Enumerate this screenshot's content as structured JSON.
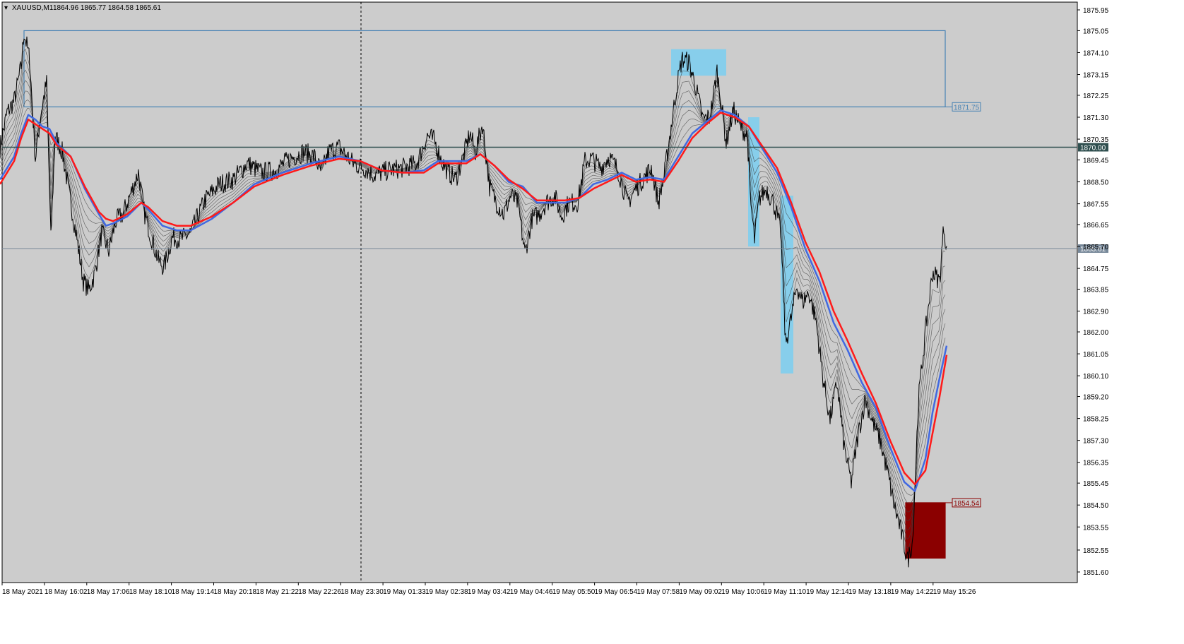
{
  "header": {
    "menu_glyph": "▾",
    "symbol": "XAUUSD,M1",
    "ohlc": "1864.96 1865.77 1864.58 1865.61"
  },
  "chart_data": {
    "type": "line",
    "title": "XAUUSD,M1",
    "ylim": [
      1851.29,
      1875.84
    ],
    "grid": false,
    "y_ticks": [
      "1875.95",
      "1875.05",
      "1874.10",
      "1873.15",
      "1872.25",
      "1871.30",
      "1870.35",
      "1869.45",
      "1868.50",
      "1867.55",
      "1866.65",
      "1865.70",
      "1864.75",
      "1863.85",
      "1862.90",
      "1862.00",
      "1861.05",
      "1860.10",
      "1859.20",
      "1858.25",
      "1857.30",
      "1856.35",
      "1855.45",
      "1854.50",
      "1853.55",
      "1852.55",
      "1851.60"
    ],
    "x_ticks": [
      "18 May 2021",
      "18 May 16:02",
      "18 May 17:06",
      "18 May 18:10",
      "18 May 19:14",
      "18 May 20:18",
      "18 May 21:22",
      "18 May 22:26",
      "18 May 23:30",
      "19 May 01:33",
      "19 May 02:38",
      "19 May 03:42",
      "19 May 04:46",
      "19 May 05:50",
      "19 May 06:54",
      "19 May 07:58",
      "19 May 09:02",
      "19 May 10:06",
      "19 May 11:10",
      "19 May 12:14",
      "19 May 13:18",
      "19 May 14:22",
      "19 May 15:26"
    ],
    "price_points": [
      [
        0,
        1870.0
      ],
      [
        10,
        1871.5
      ],
      [
        20,
        1872.0
      ],
      [
        30,
        1873.5
      ],
      [
        34,
        1875.0
      ],
      [
        42,
        1873.8
      ],
      [
        50,
        1869.5
      ],
      [
        58,
        1871.5
      ],
      [
        66,
        1872.8
      ],
      [
        72,
        1866.0
      ],
      [
        78,
        1870.5
      ],
      [
        88,
        1869.8
      ],
      [
        98,
        1868.0
      ],
      [
        108,
        1866.2
      ],
      [
        118,
        1864.2
      ],
      [
        126,
        1863.8
      ],
      [
        134,
        1864.5
      ],
      [
        144,
        1866.3
      ],
      [
        154,
        1865.5
      ],
      [
        164,
        1866.8
      ],
      [
        174,
        1867.1
      ],
      [
        184,
        1867.9
      ],
      [
        196,
        1868.9
      ],
      [
        204,
        1867.2
      ],
      [
        214,
        1866.1
      ],
      [
        224,
        1865.1
      ],
      [
        232,
        1864.8
      ],
      [
        244,
        1866.1
      ],
      [
        256,
        1866.0
      ],
      [
        270,
        1866.3
      ],
      [
        290,
        1867.7
      ],
      [
        310,
        1868.4
      ],
      [
        330,
        1868.6
      ],
      [
        350,
        1869.3
      ],
      [
        370,
        1868.9
      ],
      [
        390,
        1869.0
      ],
      [
        410,
        1869.5
      ],
      [
        430,
        1869.8
      ],
      [
        445,
        1869.6
      ],
      [
        455,
        1868.9
      ],
      [
        465,
        1869.8
      ],
      [
        480,
        1870.0
      ],
      [
        500,
        1869.3
      ],
      [
        515,
        1869.1
      ],
      [
        530,
        1868.8
      ],
      [
        550,
        1869.0
      ],
      [
        570,
        1869.1
      ],
      [
        590,
        1869.3
      ],
      [
        605,
        1870.5
      ],
      [
        615,
        1870.3
      ],
      [
        625,
        1869.4
      ],
      [
        635,
        1868.9
      ],
      [
        645,
        1868.6
      ],
      [
        655,
        1869.5
      ],
      [
        665,
        1870.6
      ],
      [
        673,
        1869.8
      ],
      [
        683,
        1871.0
      ],
      [
        693,
        1868.3
      ],
      [
        703,
        1867.6
      ],
      [
        713,
        1867.1
      ],
      [
        723,
        1867.9
      ],
      [
        733,
        1867.6
      ],
      [
        743,
        1865.4
      ],
      [
        753,
        1866.9
      ],
      [
        763,
        1867.1
      ],
      [
        773,
        1867.6
      ],
      [
        785,
        1867.9
      ],
      [
        795,
        1867.0
      ],
      [
        805,
        1867.6
      ],
      [
        818,
        1867.6
      ],
      [
        828,
        1869.4
      ],
      [
        838,
        1869.5
      ],
      [
        850,
        1869.1
      ],
      [
        862,
        1869.6
      ],
      [
        875,
        1869.0
      ],
      [
        888,
        1867.6
      ],
      [
        900,
        1868.2
      ],
      [
        912,
        1868.7
      ],
      [
        922,
        1869.1
      ],
      [
        932,
        1867.6
      ],
      [
        940,
        1868.7
      ],
      [
        950,
        1870.9
      ],
      [
        958,
        1872.6
      ],
      [
        965,
        1873.8
      ],
      [
        975,
        1873.7
      ],
      [
        985,
        1872.6
      ],
      [
        995,
        1871.2
      ],
      [
        1005,
        1871.3
      ],
      [
        1015,
        1873.3
      ],
      [
        1020,
        1872.1
      ],
      [
        1028,
        1870.2
      ],
      [
        1038,
        1871.6
      ],
      [
        1048,
        1870.9
      ],
      [
        1058,
        1870.5
      ],
      [
        1062,
        1867.8
      ],
      [
        1068,
        1866.0
      ],
      [
        1075,
        1867.8
      ],
      [
        1085,
        1868.2
      ],
      [
        1095,
        1867.6
      ],
      [
        1105,
        1866.4
      ],
      [
        1112,
        1861.5
      ],
      [
        1120,
        1862.6
      ],
      [
        1128,
        1864.0
      ],
      [
        1136,
        1863.3
      ],
      [
        1145,
        1863.7
      ],
      [
        1155,
        1862.5
      ],
      [
        1165,
        1860.0
      ],
      [
        1175,
        1858.2
      ],
      [
        1185,
        1859.8
      ],
      [
        1195,
        1857.0
      ],
      [
        1205,
        1855.5
      ],
      [
        1215,
        1857.6
      ],
      [
        1225,
        1859.1
      ],
      [
        1235,
        1858.1
      ],
      [
        1245,
        1857.4
      ],
      [
        1255,
        1856.1
      ],
      [
        1265,
        1854.6
      ],
      [
        1275,
        1853.4
      ],
      [
        1285,
        1852.1
      ],
      [
        1292,
        1853.0
      ],
      [
        1300,
        1859.0
      ],
      [
        1310,
        1862.0
      ],
      [
        1320,
        1864.6
      ],
      [
        1330,
        1864.2
      ],
      [
        1336,
        1866.6
      ],
      [
        1340,
        1865.6
      ]
    ],
    "ma_blue": [
      [
        0,
        1868.6
      ],
      [
        20,
        1869.6
      ],
      [
        30,
        1870.6
      ],
      [
        40,
        1871.4
      ],
      [
        50,
        1871.2
      ],
      [
        60,
        1870.9
      ],
      [
        70,
        1870.8
      ],
      [
        80,
        1870.2
      ],
      [
        100,
        1869.6
      ],
      [
        120,
        1868.2
      ],
      [
        140,
        1867.1
      ],
      [
        150,
        1866.6
      ],
      [
        160,
        1866.7
      ],
      [
        180,
        1867.0
      ],
      [
        200,
        1867.6
      ],
      [
        210,
        1867.3
      ],
      [
        230,
        1866.6
      ],
      [
        250,
        1866.4
      ],
      [
        270,
        1866.4
      ],
      [
        300,
        1866.9
      ],
      [
        330,
        1867.6
      ],
      [
        360,
        1868.4
      ],
      [
        400,
        1868.9
      ],
      [
        440,
        1869.3
      ],
      [
        480,
        1869.6
      ],
      [
        510,
        1869.4
      ],
      [
        540,
        1869.0
      ],
      [
        570,
        1868.9
      ],
      [
        600,
        1869.0
      ],
      [
        620,
        1869.4
      ],
      [
        640,
        1869.4
      ],
      [
        660,
        1869.4
      ],
      [
        680,
        1869.7
      ],
      [
        700,
        1869.2
      ],
      [
        720,
        1868.5
      ],
      [
        740,
        1868.3
      ],
      [
        760,
        1867.6
      ],
      [
        780,
        1867.6
      ],
      [
        800,
        1867.6
      ],
      [
        820,
        1867.8
      ],
      [
        840,
        1868.4
      ],
      [
        860,
        1868.6
      ],
      [
        880,
        1868.9
      ],
      [
        900,
        1868.6
      ],
      [
        920,
        1868.7
      ],
      [
        940,
        1868.6
      ],
      [
        960,
        1869.6
      ],
      [
        980,
        1870.6
      ],
      [
        1000,
        1871.1
      ],
      [
        1020,
        1871.6
      ],
      [
        1040,
        1871.4
      ],
      [
        1060,
        1870.9
      ],
      [
        1080,
        1869.9
      ],
      [
        1100,
        1868.9
      ],
      [
        1120,
        1867.4
      ],
      [
        1140,
        1865.6
      ],
      [
        1160,
        1864.2
      ],
      [
        1180,
        1862.4
      ],
      [
        1200,
        1861.2
      ],
      [
        1220,
        1859.8
      ],
      [
        1240,
        1858.7
      ],
      [
        1260,
        1857.0
      ],
      [
        1280,
        1855.5
      ],
      [
        1295,
        1855.1
      ],
      [
        1310,
        1856.5
      ],
      [
        1320,
        1858.5
      ],
      [
        1330,
        1860.0
      ],
      [
        1340,
        1861.4
      ]
    ],
    "ma_red": [
      [
        0,
        1868.4
      ],
      [
        20,
        1869.4
      ],
      [
        30,
        1870.4
      ],
      [
        40,
        1871.2
      ],
      [
        50,
        1871.0
      ],
      [
        60,
        1870.8
      ],
      [
        70,
        1870.6
      ],
      [
        80,
        1870.1
      ],
      [
        100,
        1869.6
      ],
      [
        120,
        1868.3
      ],
      [
        140,
        1867.2
      ],
      [
        150,
        1866.9
      ],
      [
        160,
        1866.8
      ],
      [
        180,
        1867.1
      ],
      [
        200,
        1867.6
      ],
      [
        210,
        1867.4
      ],
      [
        230,
        1866.8
      ],
      [
        250,
        1866.6
      ],
      [
        270,
        1866.6
      ],
      [
        300,
        1867.0
      ],
      [
        330,
        1867.6
      ],
      [
        360,
        1868.3
      ],
      [
        400,
        1868.8
      ],
      [
        440,
        1869.2
      ],
      [
        480,
        1869.5
      ],
      [
        510,
        1869.4
      ],
      [
        540,
        1869.0
      ],
      [
        570,
        1868.9
      ],
      [
        600,
        1868.9
      ],
      [
        620,
        1869.3
      ],
      [
        640,
        1869.3
      ],
      [
        660,
        1869.3
      ],
      [
        680,
        1869.7
      ],
      [
        700,
        1869.2
      ],
      [
        720,
        1868.6
      ],
      [
        740,
        1868.2
      ],
      [
        760,
        1867.7
      ],
      [
        780,
        1867.7
      ],
      [
        800,
        1867.7
      ],
      [
        820,
        1867.8
      ],
      [
        840,
        1868.2
      ],
      [
        860,
        1868.5
      ],
      [
        880,
        1868.8
      ],
      [
        900,
        1868.5
      ],
      [
        920,
        1868.6
      ],
      [
        940,
        1868.5
      ],
      [
        960,
        1869.4
      ],
      [
        980,
        1870.4
      ],
      [
        1000,
        1871.0
      ],
      [
        1020,
        1871.5
      ],
      [
        1040,
        1871.3
      ],
      [
        1060,
        1870.9
      ],
      [
        1080,
        1870.0
      ],
      [
        1100,
        1869.1
      ],
      [
        1120,
        1867.6
      ],
      [
        1140,
        1865.9
      ],
      [
        1160,
        1864.6
      ],
      [
        1180,
        1862.9
      ],
      [
        1200,
        1861.6
      ],
      [
        1220,
        1860.2
      ],
      [
        1240,
        1858.9
      ],
      [
        1260,
        1857.3
      ],
      [
        1280,
        1855.9
      ],
      [
        1295,
        1855.4
      ],
      [
        1310,
        1856.0
      ],
      [
        1320,
        1857.6
      ],
      [
        1330,
        1859.2
      ],
      [
        1340,
        1861.0
      ]
    ],
    "hlines": [
      {
        "price": 1870.0,
        "label": "1870.00",
        "color": "#2f4f4f"
      },
      {
        "price": 1865.61,
        "label": "1865.61",
        "color": "#778899"
      }
    ],
    "zones": [
      {
        "x0": 34,
        "x1": 1338,
        "top": 1875.05,
        "bottom": 1871.75,
        "label": "1871.75",
        "stroke": "#4682b4",
        "fill": "none"
      },
      {
        "x0": 950,
        "x1": 1028,
        "top": 1874.25,
        "bottom": 1873.1,
        "fill": "#87ceeb"
      },
      {
        "x0": 1059,
        "x1": 1075,
        "top": 1871.3,
        "bottom": 1865.7,
        "fill": "#87ceeb"
      },
      {
        "x0": 1105,
        "x1": 1123,
        "top": 1867.9,
        "bottom": 1860.2,
        "fill": "#87ceeb"
      },
      {
        "x0": 1282,
        "x1": 1338,
        "top": 1854.6,
        "bottom": 1852.2,
        "label": "1854.54",
        "stroke": "#8b0000",
        "fill": "#8b0000"
      }
    ],
    "vline_x": 511
  },
  "colors": {
    "background": "#cccccc",
    "price": "#000000",
    "ma_blue": "#4169e1",
    "ma_red": "#ff1a1a",
    "ribbon": "#404040",
    "frame": "#000000"
  }
}
